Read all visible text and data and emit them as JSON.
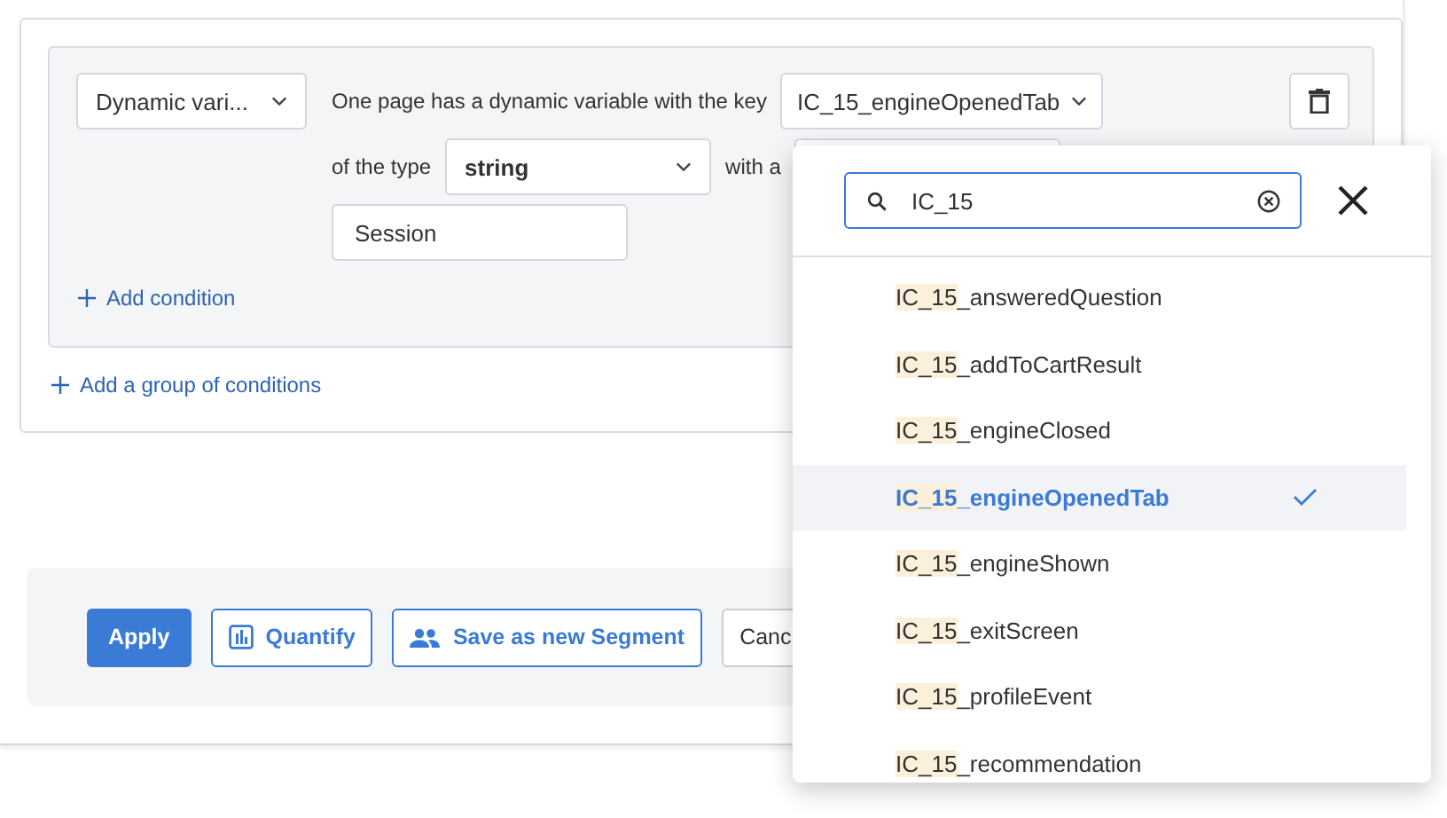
{
  "condition": {
    "category_select": "Dynamic vari...",
    "key_label": "One page has a dynamic variable with the key",
    "key_select": "IC_15_engineOpenedTab",
    "type_label": "of the type",
    "type_select": "string",
    "value_label": "with a",
    "scope_field": "Session",
    "add_condition": "Add condition"
  },
  "add_group": "Add a group of conditions",
  "buttons": [
    {
      "kind": "primary",
      "label": "Apply"
    },
    {
      "kind": "chart",
      "label": "Quantify"
    },
    {
      "kind": "people",
      "label": "Save as new Segment"
    },
    {
      "kind": "plain",
      "label": "Canc"
    }
  ],
  "dropdown": {
    "search": {
      "value": "IC_15"
    },
    "options": [
      {
        "match": "IC_15",
        "rest": "_answeredQuestion",
        "selected": false
      },
      {
        "match": "IC_15",
        "rest": "_addToCartResult",
        "selected": false
      },
      {
        "match": "IC_15",
        "rest": "_engineClosed",
        "selected": false
      },
      {
        "match": "IC_15",
        "rest": "_engineOpenedTab",
        "selected": true
      },
      {
        "match": "IC_15",
        "rest": "_engineShown",
        "selected": false
      },
      {
        "match": "IC_15",
        "rest": "_exitScreen",
        "selected": false
      },
      {
        "match": "IC_15",
        "rest": "_profileEvent",
        "selected": false
      },
      {
        "match": "IC_15",
        "rest": "_recommendation",
        "selected": false
      }
    ]
  }
}
